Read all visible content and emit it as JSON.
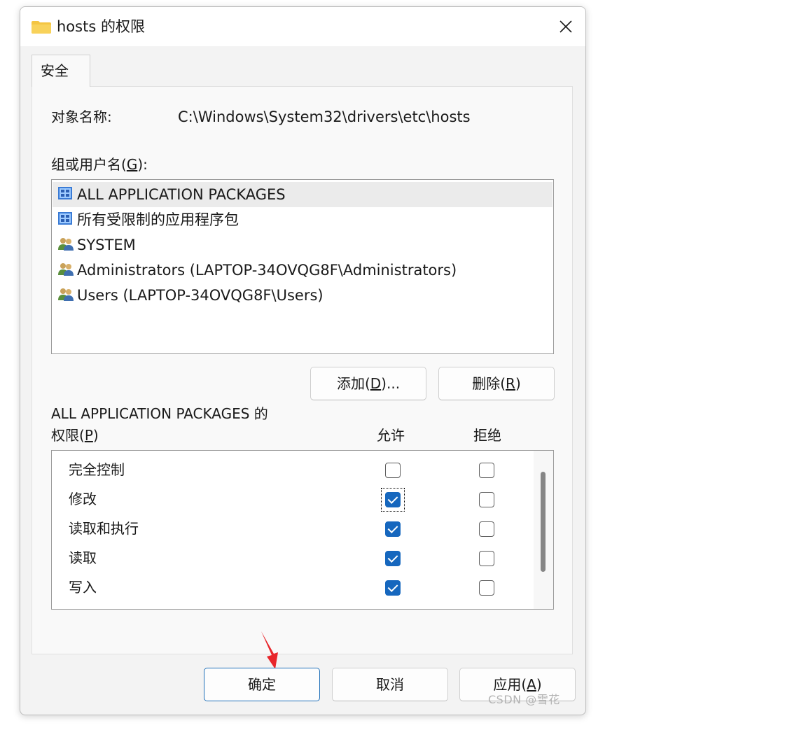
{
  "window": {
    "title": "hosts 的权限",
    "close_glyph": "✕"
  },
  "tabs": [
    {
      "label": "安全"
    }
  ],
  "object": {
    "label": "对象名称:",
    "value": "C:\\Windows\\System32\\drivers\\etc\\hosts"
  },
  "groups": {
    "label": "组或用户名(G):",
    "label_text": "组或用户名(",
    "label_key": "G",
    "label_tail": "):",
    "items": [
      {
        "name": "ALL APPLICATION PACKAGES",
        "icon": "package-group-icon",
        "selected": true
      },
      {
        "name": "所有受限制的应用程序包",
        "icon": "package-group-icon",
        "selected": false
      },
      {
        "name": "SYSTEM",
        "icon": "users-group-icon",
        "selected": false
      },
      {
        "name": "Administrators (LAPTOP-34OVQG8F\\Administrators)",
        "icon": "users-group-icon",
        "selected": false
      },
      {
        "name": "Users (LAPTOP-34OVQG8F\\Users)",
        "icon": "users-group-icon",
        "selected": false
      }
    ]
  },
  "buttons": {
    "add": {
      "text": "添加(",
      "key": "D",
      "tail": ")..."
    },
    "remove": {
      "text": "删除(",
      "key": "R",
      "tail": ")"
    },
    "ok": {
      "text": "确定"
    },
    "cancel": {
      "text": "取消"
    },
    "apply": {
      "text": "应用(",
      "key": "A",
      "tail": ")"
    }
  },
  "permissions": {
    "title_line1": "ALL APPLICATION PACKAGES 的",
    "title_line2_text": "权限(",
    "title_line2_key": "P",
    "title_line2_tail": ")",
    "allow_header": "允许",
    "deny_header": "拒绝",
    "rows": [
      {
        "name": "完全控制",
        "allow": false,
        "deny": false
      },
      {
        "name": "修改",
        "allow": true,
        "deny": false,
        "focused": true
      },
      {
        "name": "读取和执行",
        "allow": true,
        "deny": false
      },
      {
        "name": "读取",
        "allow": true,
        "deny": false
      },
      {
        "name": "写入",
        "allow": true,
        "deny": false
      }
    ]
  },
  "annotation": {
    "arrow_color": "#e8262b",
    "icon": "red-arrow-icon"
  },
  "watermark": "CSDN @雪花",
  "colors": {
    "accent": "#1667be",
    "folder": "#f4c542"
  }
}
